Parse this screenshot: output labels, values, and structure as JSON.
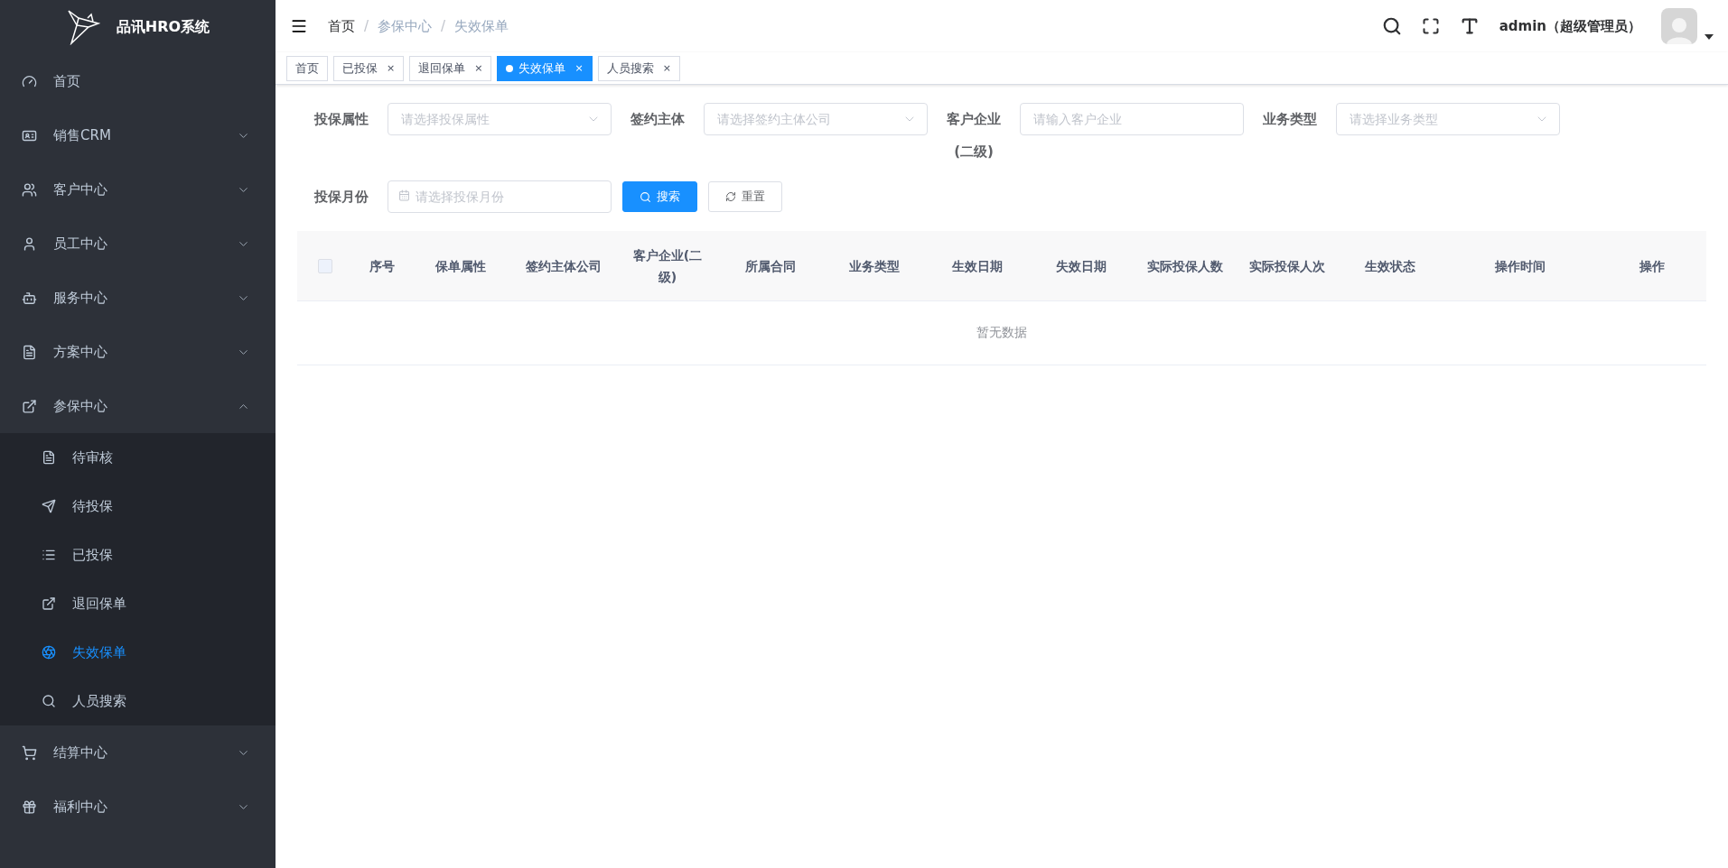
{
  "sidebar": {
    "title": "品讯HRO系统",
    "items": [
      {
        "label": "首页",
        "selected": false,
        "kind": "link"
      },
      {
        "label": "销售CRM",
        "selected": false,
        "expanded": false,
        "kind": "group"
      },
      {
        "label": "客户中心",
        "selected": false,
        "expanded": false,
        "kind": "group"
      },
      {
        "label": "员工中心",
        "selected": false,
        "expanded": false,
        "kind": "group"
      },
      {
        "label": "服务中心",
        "selected": false,
        "expanded": false,
        "kind": "group"
      },
      {
        "label": "方案中心",
        "selected": false,
        "expanded": false,
        "kind": "group"
      },
      {
        "label": "参保中心",
        "selected": false,
        "expanded": true,
        "kind": "group",
        "children": [
          {
            "label": "待审核",
            "selected": false
          },
          {
            "label": "待投保",
            "selected": false
          },
          {
            "label": "已投保",
            "selected": false
          },
          {
            "label": "退回保单",
            "selected": false
          },
          {
            "label": "失效保单",
            "selected": true
          },
          {
            "label": "人员搜索",
            "selected": false
          }
        ]
      },
      {
        "label": "结算中心",
        "selected": false,
        "expanded": false,
        "kind": "group"
      },
      {
        "label": "福利中心",
        "selected": false,
        "expanded": false,
        "kind": "group"
      }
    ]
  },
  "breadcrumb": {
    "items": [
      "首页",
      "参保中心",
      "失效保单"
    ],
    "separators": [
      "/",
      "/"
    ]
  },
  "user": {
    "name": "admin（超级管理员）"
  },
  "tabs": [
    {
      "label": "首页",
      "selected": false
    },
    {
      "label": "已投保",
      "selected": false,
      "close": "×"
    },
    {
      "label": "退回保单",
      "selected": false,
      "close": "×"
    },
    {
      "label": "失效保单",
      "selected": true,
      "close": "×"
    },
    {
      "label": "人员搜索",
      "selected": false,
      "close": "×"
    }
  ],
  "filters": [
    {
      "label": "投保属性",
      "kind": "select",
      "placeholder": "请选择投保属性"
    },
    {
      "label": "签约主体",
      "kind": "select",
      "placeholder": "请选择签约主体公司"
    },
    {
      "label": "客户企业(二级)",
      "kind": "input",
      "placeholder": "请输入客户企业"
    },
    {
      "label": "业务类型",
      "kind": "select",
      "placeholder": "请选择业务类型"
    },
    {
      "label": "投保月份",
      "kind": "month",
      "placeholder": "请选择投保月份"
    }
  ],
  "buttons": [
    {
      "label": "搜索",
      "kind": "primary"
    },
    {
      "label": "重置",
      "kind": "plain"
    }
  ],
  "table": {
    "select_all": {
      "checked": false
    },
    "columns": [
      "序号",
      "保单属性",
      "签约主体公司",
      "客户企业(二级)",
      "所属合同",
      "业务类型",
      "生效日期",
      "失效日期",
      "实际投保人数",
      "实际投保人次",
      "生效状态",
      "操作时间",
      "操作"
    ],
    "empty_text": "暂无数据"
  }
}
